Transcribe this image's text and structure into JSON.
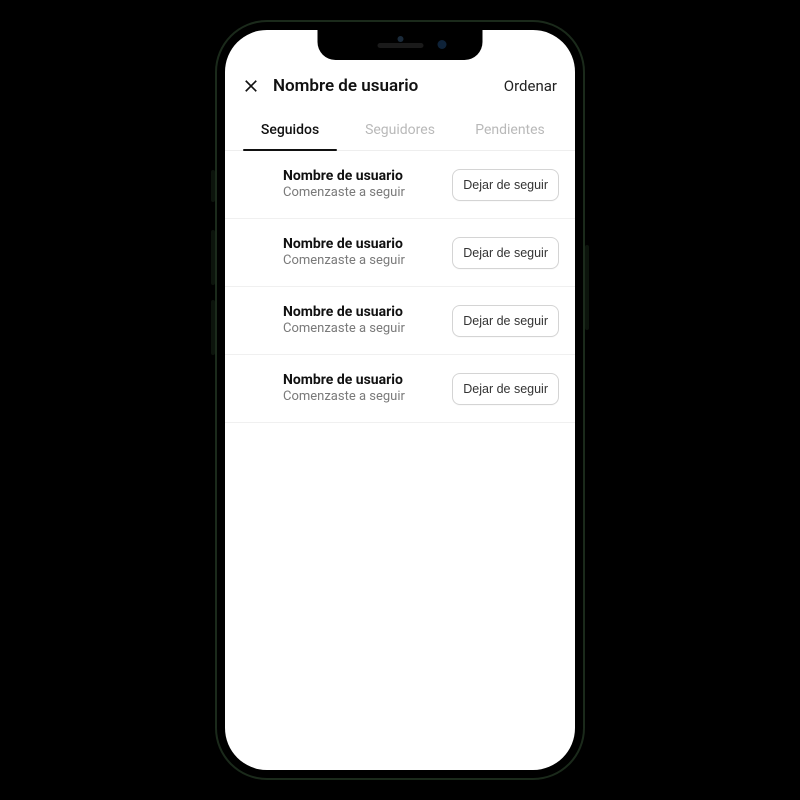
{
  "header": {
    "title": "Nombre de usuario",
    "sort_label": "Ordenar"
  },
  "tabs": [
    {
      "label": "Seguidos",
      "active": true
    },
    {
      "label": "Seguidores",
      "active": false
    },
    {
      "label": "Pendientes",
      "active": false
    }
  ],
  "list": {
    "unfollow_label": "Dejar de seguir",
    "items": [
      {
        "name": "Nombre de usuario",
        "sub": "Comenzaste a seguir"
      },
      {
        "name": "Nombre de usuario",
        "sub": "Comenzaste a seguir"
      },
      {
        "name": "Nombre de usuario",
        "sub": "Comenzaste a seguir"
      },
      {
        "name": "Nombre de usuario",
        "sub": "Comenzaste a seguir"
      }
    ]
  }
}
